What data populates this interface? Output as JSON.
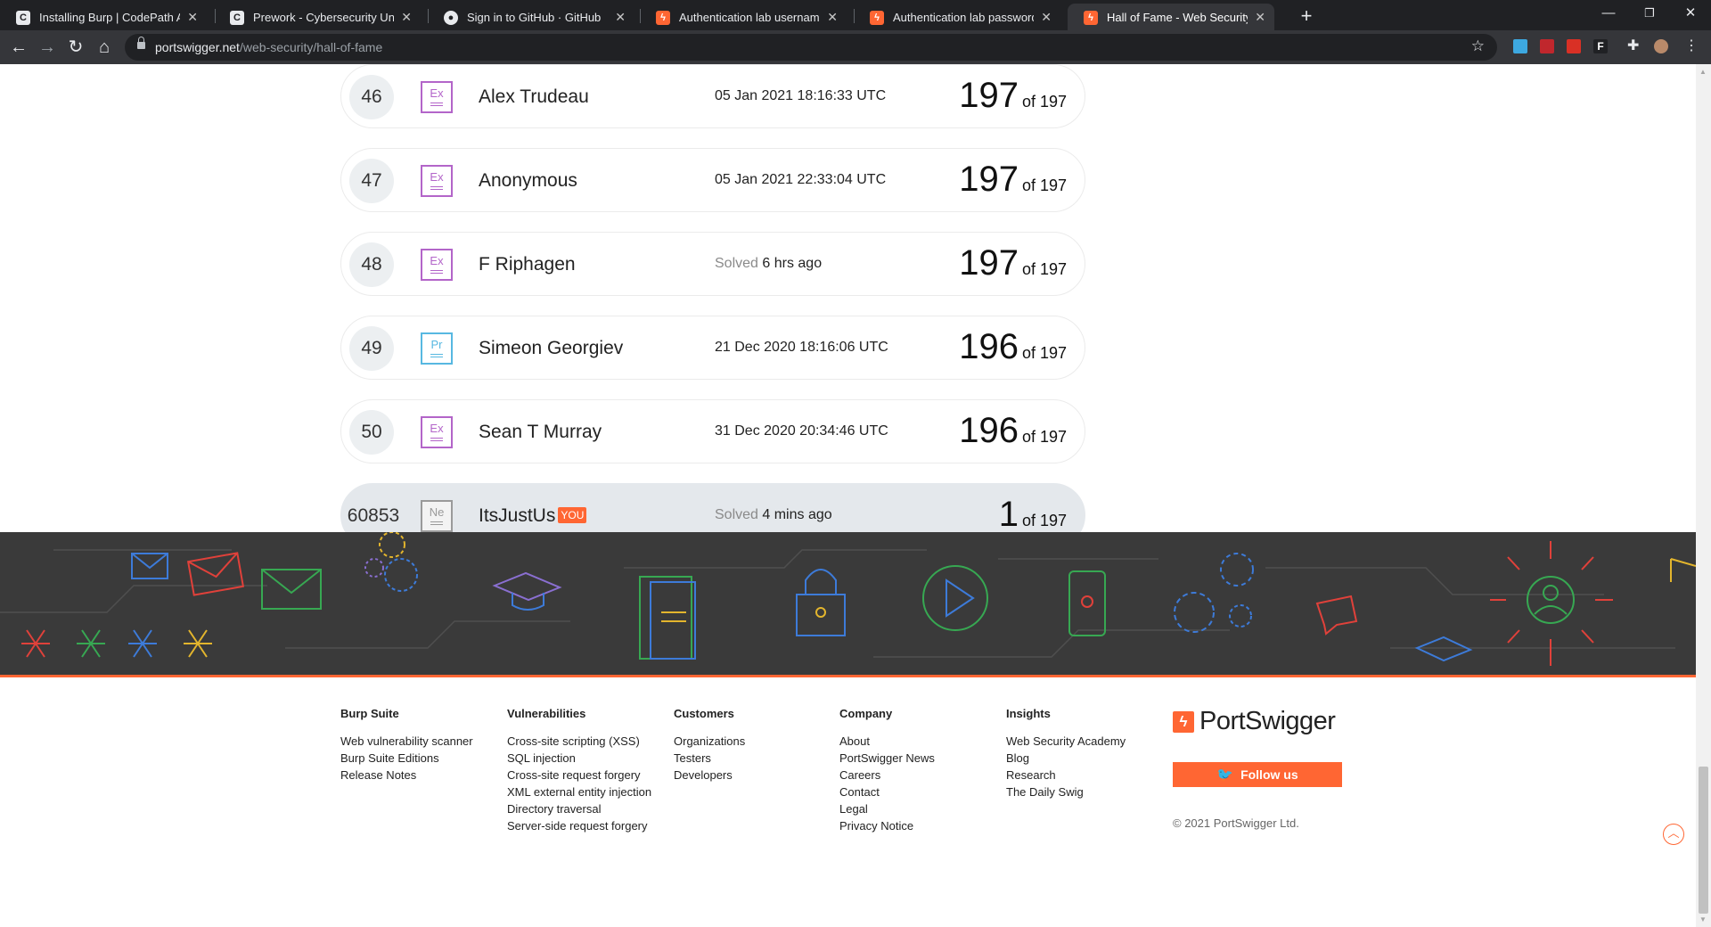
{
  "browser": {
    "tabs": [
      {
        "title": "Installing Burp | CodePath Andro",
        "favicon": "codepath-icon"
      },
      {
        "title": "Prework - Cybersecurity Universi",
        "favicon": "codepath-icon"
      },
      {
        "title": "Sign in to GitHub · GitHub",
        "favicon": "github-icon"
      },
      {
        "title": "Authentication lab usernames | W",
        "favicon": "portswigger-icon"
      },
      {
        "title": "Authentication lab passwords | W",
        "favicon": "portswigger-icon"
      },
      {
        "title": "Hall of Fame - Web Security Acad",
        "favicon": "portswigger-icon",
        "active": true
      }
    ],
    "url_host": "portswigger.net",
    "url_path": "/web-security/hall-of-fame"
  },
  "leaderboard": {
    "rows": [
      {
        "rank": "46",
        "level": "Ex",
        "name": "Alex Trudeau",
        "time": "05 Jan 2021 18:16:33 UTC",
        "score": "197",
        "of": "of 197"
      },
      {
        "rank": "47",
        "level": "Ex",
        "name": "Anonymous",
        "time": "05 Jan 2021 22:33:04 UTC",
        "score": "197",
        "of": "of 197"
      },
      {
        "rank": "48",
        "level": "Ex",
        "name": "F Riphagen",
        "solved_label": "Solved",
        "time": "6 hrs ago",
        "score": "197",
        "of": "of 197"
      },
      {
        "rank": "49",
        "level": "Pr",
        "name": "Simeon Georgiev",
        "time": "21 Dec 2020 18:16:06 UTC",
        "score": "196",
        "of": "of 197"
      },
      {
        "rank": "50",
        "level": "Ex",
        "name": "Sean T Murray",
        "time": "31 Dec 2020 20:34:46 UTC",
        "score": "196",
        "of": "of 197"
      }
    ],
    "me": {
      "rank": "60853",
      "level": "Ne",
      "name": "ItsJustUs",
      "you_label": "YOU",
      "solved_label": "Solved",
      "time": "4 mins ago",
      "score": "1",
      "of": "of 197"
    }
  },
  "footer": {
    "columns": [
      {
        "heading": "Burp Suite",
        "links": [
          "Web vulnerability scanner",
          "Burp Suite Editions",
          "Release Notes"
        ]
      },
      {
        "heading": "Vulnerabilities",
        "links": [
          "Cross-site scripting (XSS)",
          "SQL injection",
          "Cross-site request forgery",
          "XML external entity injection",
          "Directory traversal",
          "Server-side request forgery"
        ]
      },
      {
        "heading": "Customers",
        "links": [
          "Organizations",
          "Testers",
          "Developers"
        ]
      },
      {
        "heading": "Company",
        "links": [
          "About",
          "PortSwigger News",
          "Careers",
          "Contact",
          "Legal",
          "Privacy Notice"
        ]
      },
      {
        "heading": "Insights",
        "links": [
          "Web Security Academy",
          "Blog",
          "Research",
          "The Daily Swig"
        ]
      }
    ],
    "brand": "PortSwigger",
    "follow_label": "Follow us",
    "copyright": "© 2021 PortSwigger Ltd."
  },
  "colors": {
    "accent": "#ff6633",
    "expert_badge": "#b365c9",
    "practitioner_badge": "#57b8e1",
    "banner_bg": "#3a3a3a"
  }
}
